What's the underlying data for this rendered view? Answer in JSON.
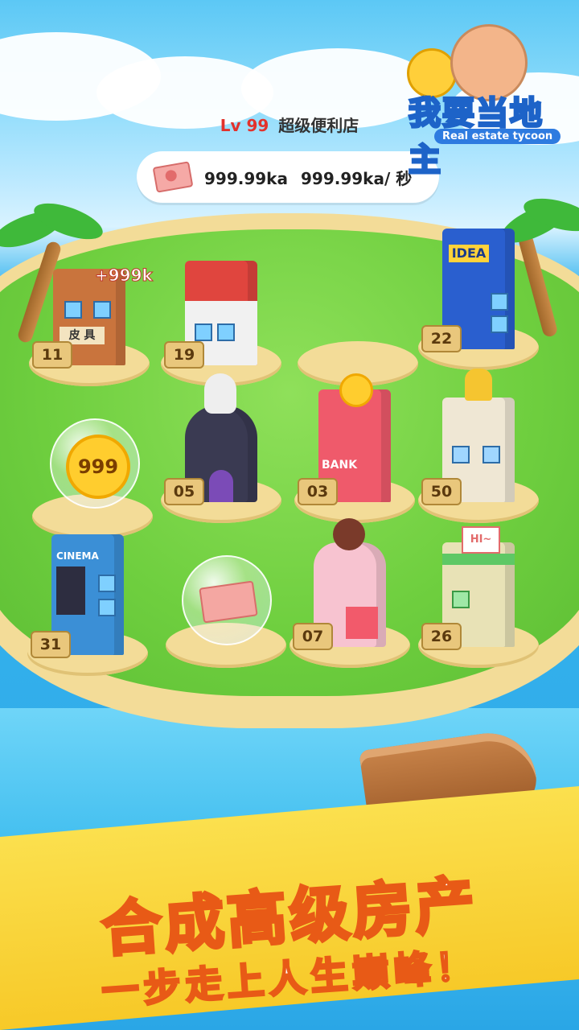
{
  "header": {
    "level": "Lv 99",
    "shop_name": "超级便利店",
    "money_total": "999.99ka",
    "money_rate": "999.99ka/ 秒"
  },
  "logo": {
    "title": "我要当地主",
    "subtitle": "Real estate tycoon"
  },
  "floating_reward": "+999k",
  "slots": [
    {
      "badge": "11",
      "type": "building",
      "name": "leather-goods-shop",
      "sign": "皮 具",
      "color": "#c9743d"
    },
    {
      "badge": "19",
      "type": "building",
      "name": "cigarette-shop",
      "color": "#e0453e"
    },
    {
      "badge": "",
      "type": "empty"
    },
    {
      "badge": "22",
      "type": "building",
      "name": "idea-store",
      "sign": "IDEA",
      "color": "#2a5fcf"
    },
    {
      "badge": "",
      "type": "coin-bubble",
      "value": "999"
    },
    {
      "badge": "05",
      "type": "building",
      "name": "magic-hat-building",
      "color": "#3a3a52"
    },
    {
      "badge": "03",
      "type": "building",
      "name": "piggy-bank",
      "sign": "BANK",
      "color": "#ef5a6b"
    },
    {
      "badge": "50",
      "type": "building",
      "name": "palace",
      "color": "#efe7d4"
    },
    {
      "badge": "31",
      "type": "building",
      "name": "cinema",
      "sign": "CINEMA",
      "color": "#3b8fd6"
    },
    {
      "badge": "",
      "type": "cash-bubble"
    },
    {
      "badge": "07",
      "type": "building",
      "name": "cake-shop",
      "color": "#f7c3d0"
    },
    {
      "badge": "26",
      "type": "building",
      "name": "letter-house",
      "sign": "HI~",
      "color": "#e8e2b6"
    }
  ],
  "banner": {
    "line1": "合成高级房产",
    "line2": "一步走上人生巅峰！"
  }
}
